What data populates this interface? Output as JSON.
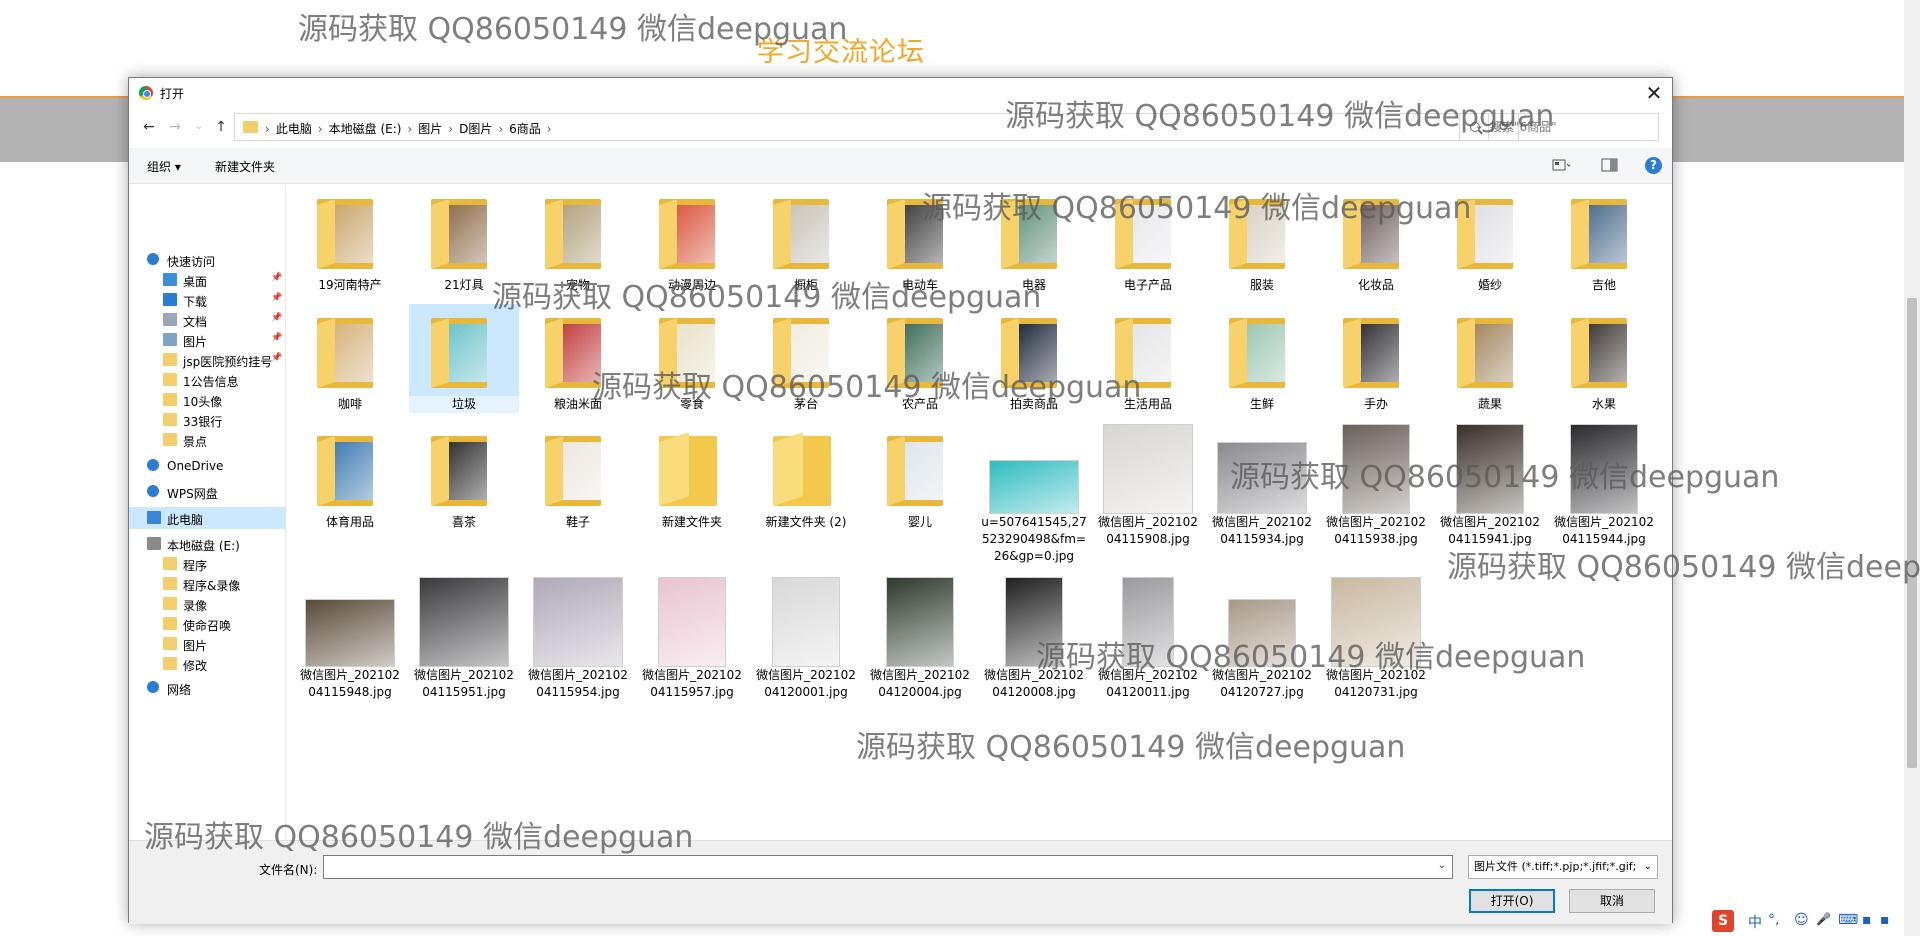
{
  "page": {
    "title": "学习交流论坛"
  },
  "watermark": "源码获取 QQ86050149 微信deepguan",
  "dialog": {
    "title": "打开",
    "close": "✕",
    "nav": {
      "back": "←",
      "forward": "→",
      "up": "↑"
    },
    "breadcrumbs": [
      "此电脑",
      "本地磁盘 (E:)",
      "图片",
      "D图片",
      "6商品"
    ],
    "breadcrumb_sep": "›",
    "search_placeholder": "搜索\"6商品\"",
    "toolbar": {
      "organize": "组织 ▾",
      "new_folder": "新建文件夹",
      "help": "?"
    },
    "sidebar": [
      {
        "label": "快速访问",
        "icon": "star-icon",
        "pinned": false
      },
      {
        "label": "桌面",
        "icon": "desktop-icon",
        "pinned": true
      },
      {
        "label": "下载",
        "icon": "download-icon",
        "pinned": true
      },
      {
        "label": "文档",
        "icon": "document-icon",
        "pinned": true
      },
      {
        "label": "图片",
        "icon": "pictures-icon",
        "pinned": true
      },
      {
        "label": "jsp医院预约挂号",
        "icon": "folder-icon",
        "pinned": true
      },
      {
        "label": "1公告信息",
        "icon": "folder-icon",
        "pinned": false
      },
      {
        "label": "10头像",
        "icon": "folder-icon",
        "pinned": false
      },
      {
        "label": "33银行",
        "icon": "folder-icon",
        "pinned": false
      },
      {
        "label": "景点",
        "icon": "folder-icon",
        "pinned": false
      },
      {
        "label": "OneDrive",
        "icon": "cloud-icon",
        "pinned": false
      },
      {
        "label": "WPS网盘",
        "icon": "cloud-icon",
        "pinned": false
      },
      {
        "label": "此电脑",
        "icon": "computer-icon",
        "pinned": false,
        "selected": true
      },
      {
        "label": "本地磁盘 (E:)",
        "icon": "drive-icon",
        "pinned": false
      },
      {
        "label": "程序",
        "icon": "folder-icon",
        "pinned": false
      },
      {
        "label": "程序&录像",
        "icon": "folder-icon",
        "pinned": false
      },
      {
        "label": "录像",
        "icon": "folder-icon",
        "pinned": false
      },
      {
        "label": "使命召唤",
        "icon": "folder-icon",
        "pinned": false
      },
      {
        "label": "图片",
        "icon": "folder-icon",
        "pinned": false
      },
      {
        "label": "修改",
        "icon": "folder-icon",
        "pinned": false
      },
      {
        "label": "网络",
        "icon": "network-icon",
        "pinned": false
      }
    ],
    "items": [
      {
        "label": "19河南特产",
        "kind": "folder",
        "color": "#c9a46b"
      },
      {
        "label": "21灯具",
        "kind": "folder",
        "color": "#8a6a45"
      },
      {
        "label": "宠物",
        "kind": "folder",
        "color": "#b0a07a"
      },
      {
        "label": "动漫周边",
        "kind": "folder",
        "color": "#d9533a"
      },
      {
        "label": "橱柜",
        "kind": "folder",
        "color": "#c7c2b8"
      },
      {
        "label": "电动车",
        "kind": "folder",
        "color": "#3a3a3a"
      },
      {
        "label": "电器",
        "kind": "folder",
        "color": "#5f8f7a"
      },
      {
        "label": "电子产品",
        "kind": "folder",
        "color": "#e8e8ec"
      },
      {
        "label": "服装",
        "kind": "folder",
        "color": "#d8d2c2"
      },
      {
        "label": "化妆品",
        "kind": "folder",
        "color": "#6a5a58"
      },
      {
        "label": "婚纱",
        "kind": "folder",
        "color": "#e0e0e4"
      },
      {
        "label": "吉他",
        "kind": "folder",
        "color": "#4a6a8a"
      },
      {
        "label": "咖啡",
        "kind": "folder",
        "color": "#d4b07a"
      },
      {
        "label": "垃圾",
        "kind": "folder",
        "color": "#6ac2c8",
        "selected": true
      },
      {
        "label": "粮油米面",
        "kind": "folder",
        "color": "#c03a3a"
      },
      {
        "label": "零食",
        "kind": "folder",
        "color": "#e8e2c8"
      },
      {
        "label": "茅台",
        "kind": "folder",
        "color": "#f0ece0"
      },
      {
        "label": "农产品",
        "kind": "folder",
        "color": "#3a6a58"
      },
      {
        "label": "拍卖商品",
        "kind": "folder",
        "color": "#1a2438"
      },
      {
        "label": "生活用品",
        "kind": "folder",
        "color": "#e4e4e4"
      },
      {
        "label": "生鲜",
        "kind": "folder",
        "color": "#9ac4b0"
      },
      {
        "label": "手办",
        "kind": "folder",
        "color": "#2a2a30"
      },
      {
        "label": "蔬果",
        "kind": "folder",
        "color": "#a0845a"
      },
      {
        "label": "水果",
        "kind": "folder",
        "color": "#3a3430"
      },
      {
        "label": "体育用品",
        "kind": "folder",
        "color": "#3a78b0"
      },
      {
        "label": "喜茶",
        "kind": "folder",
        "color": "#2a2a2a"
      },
      {
        "label": "鞋子",
        "kind": "folder",
        "color": "#ece6e0"
      },
      {
        "label": "新建文件夹",
        "kind": "empty",
        "color": "#f2c94c"
      },
      {
        "label": "新建文件夹 (2)",
        "kind": "empty",
        "color": "#f2c94c"
      },
      {
        "label": "婴儿",
        "kind": "folder",
        "color": "#dde4ea"
      },
      {
        "label": "u=507641545,27523290498&fm=26&gp=0.jpg",
        "kind": "image",
        "color": "#2fbcc0"
      },
      {
        "label": "微信图片_20210204115908.jpg",
        "kind": "image",
        "color": "#d8d6d2"
      },
      {
        "label": "微信图片_20210204115934.jpg",
        "kind": "image",
        "color": "#8a8a90"
      },
      {
        "label": "微信图片_20210204115938.jpg",
        "kind": "image",
        "color": "#6a6058"
      },
      {
        "label": "微信图片_20210204115941.jpg",
        "kind": "image",
        "color": "#3a3028"
      },
      {
        "label": "微信图片_20210204115944.jpg",
        "kind": "image",
        "color": "#2a2a2e"
      },
      {
        "label": "微信图片_20210204115948.jpg",
        "kind": "image",
        "color": "#5a4a38"
      },
      {
        "label": "微信图片_20210204115951.jpg",
        "kind": "image",
        "color": "#3a3a3e"
      },
      {
        "label": "微信图片_20210204115954.jpg",
        "kind": "image",
        "color": "#b0a8b8"
      },
      {
        "label": "微信图片_20210204115957.jpg",
        "kind": "image",
        "color": "#e8c4d0"
      },
      {
        "label": "微信图片_20210204120001.jpg",
        "kind": "image",
        "color": "#d8d8d8"
      },
      {
        "label": "微信图片_20210204120004.jpg",
        "kind": "image",
        "color": "#2e3a2e"
      },
      {
        "label": "微信图片_20210204120008.jpg",
        "kind": "image",
        "color": "#202020"
      },
      {
        "label": "微信图片_20210204120011.jpg",
        "kind": "image",
        "color": "#9a9a9e"
      },
      {
        "label": "微信图片_20210204120727.jpg",
        "kind": "image",
        "color": "#a89888"
      },
      {
        "label": "微信图片_20210204120731.jpg",
        "kind": "image",
        "color": "#c8b8a0"
      }
    ],
    "bottom": {
      "filename_label": "文件名(N):",
      "filename_value": "",
      "filter": "图片文件 (*.tiff;*.pjp;*.jfif;*.gif;",
      "open": "打开(O)",
      "cancel": "取消"
    }
  },
  "ime": {
    "logo": "S",
    "lang": "中",
    "punct": "°,",
    "emoji": "☺",
    "mic": "🎤",
    "keyboard": "⌨",
    "more": "▪"
  }
}
